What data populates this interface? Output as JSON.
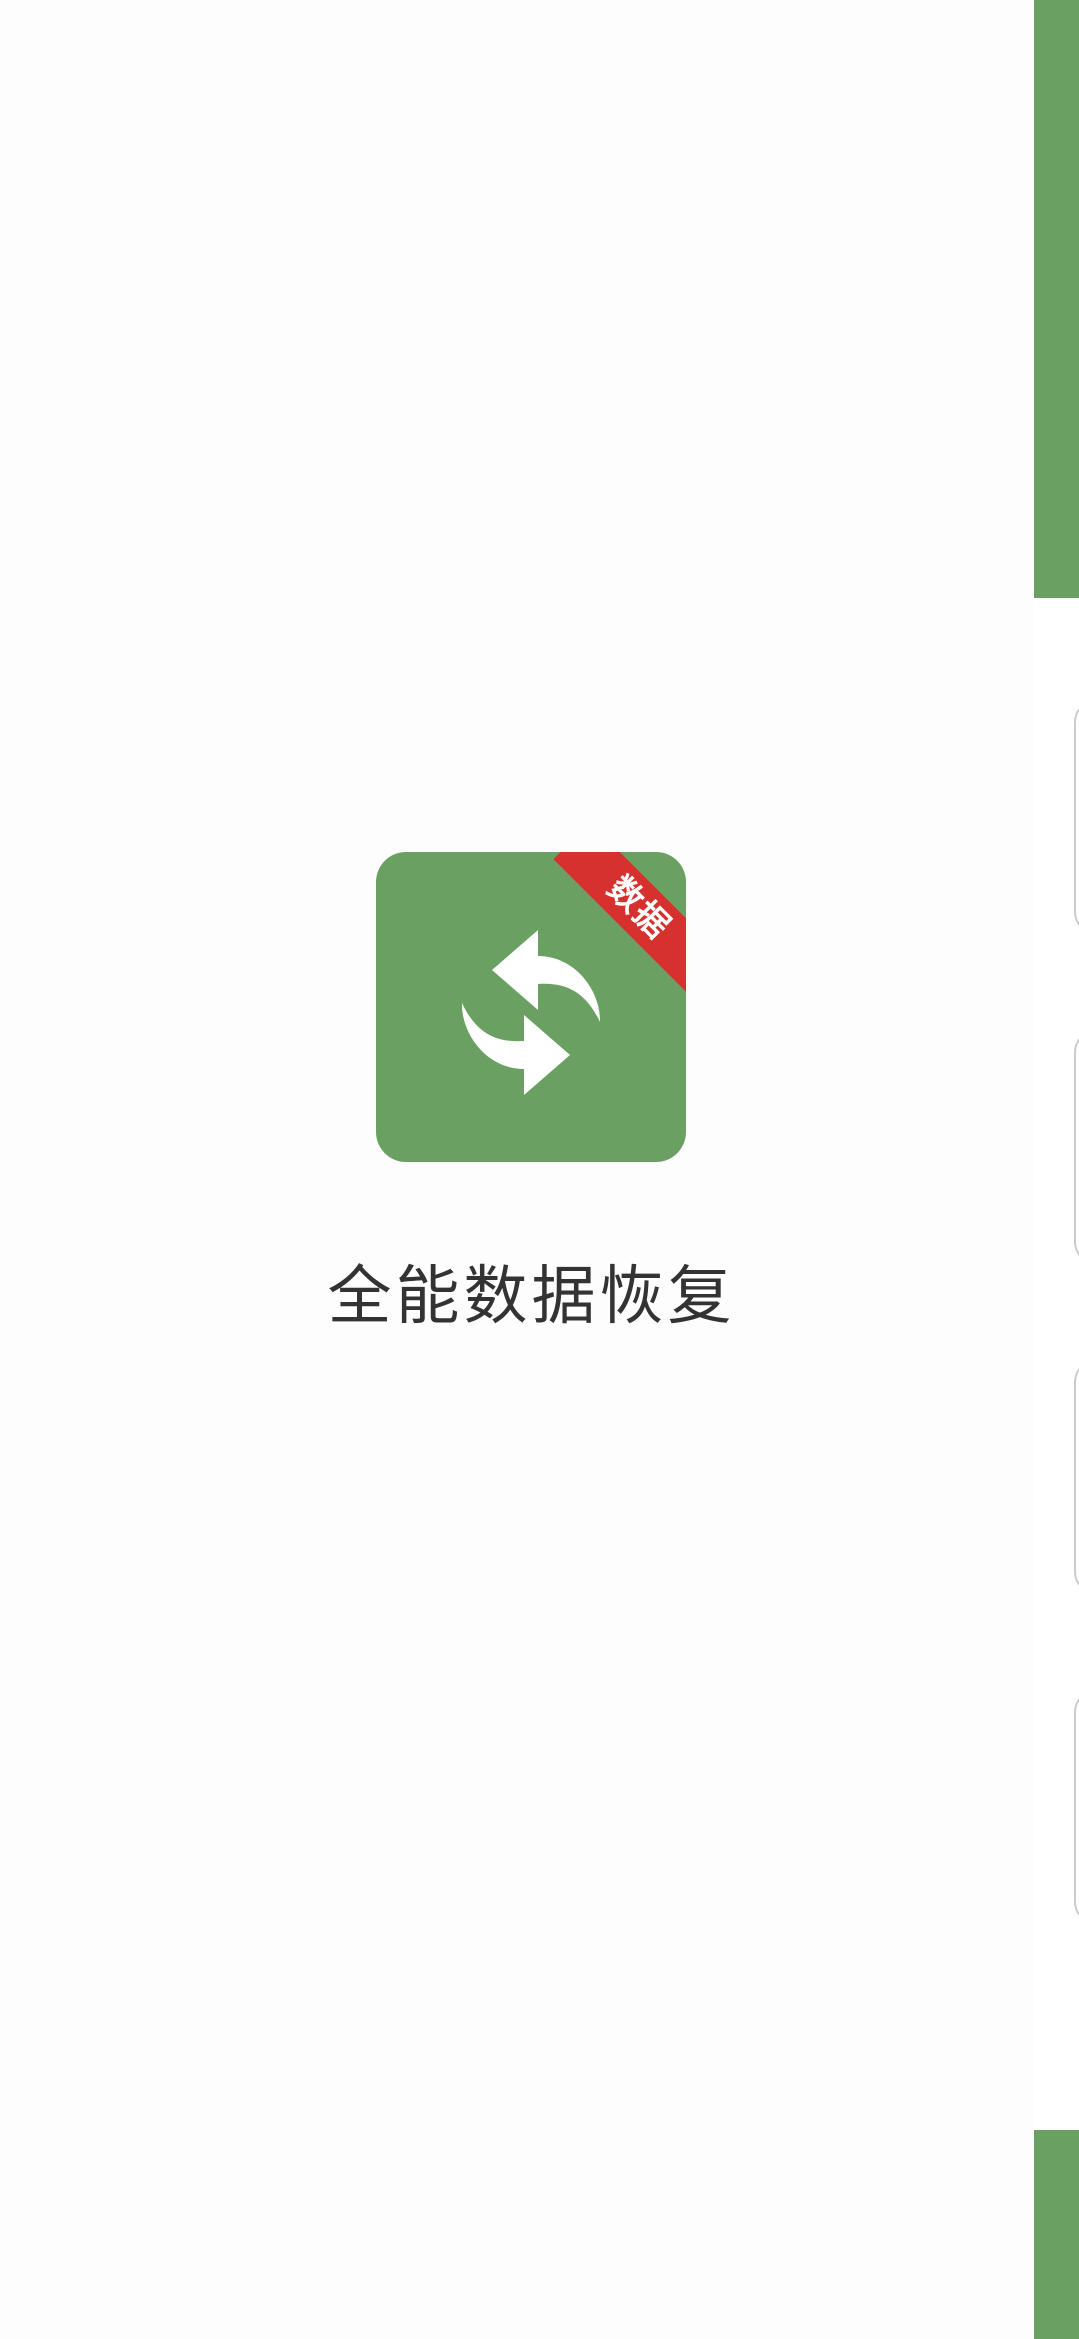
{
  "app": {
    "title": "全能数据恢复",
    "badge_text": "数据",
    "icon": "sync-arrows-icon"
  },
  "colors": {
    "brand_green": "#6aa163",
    "badge_red": "#d6302f",
    "background": "#fdfdfd",
    "title_text": "#333333"
  }
}
